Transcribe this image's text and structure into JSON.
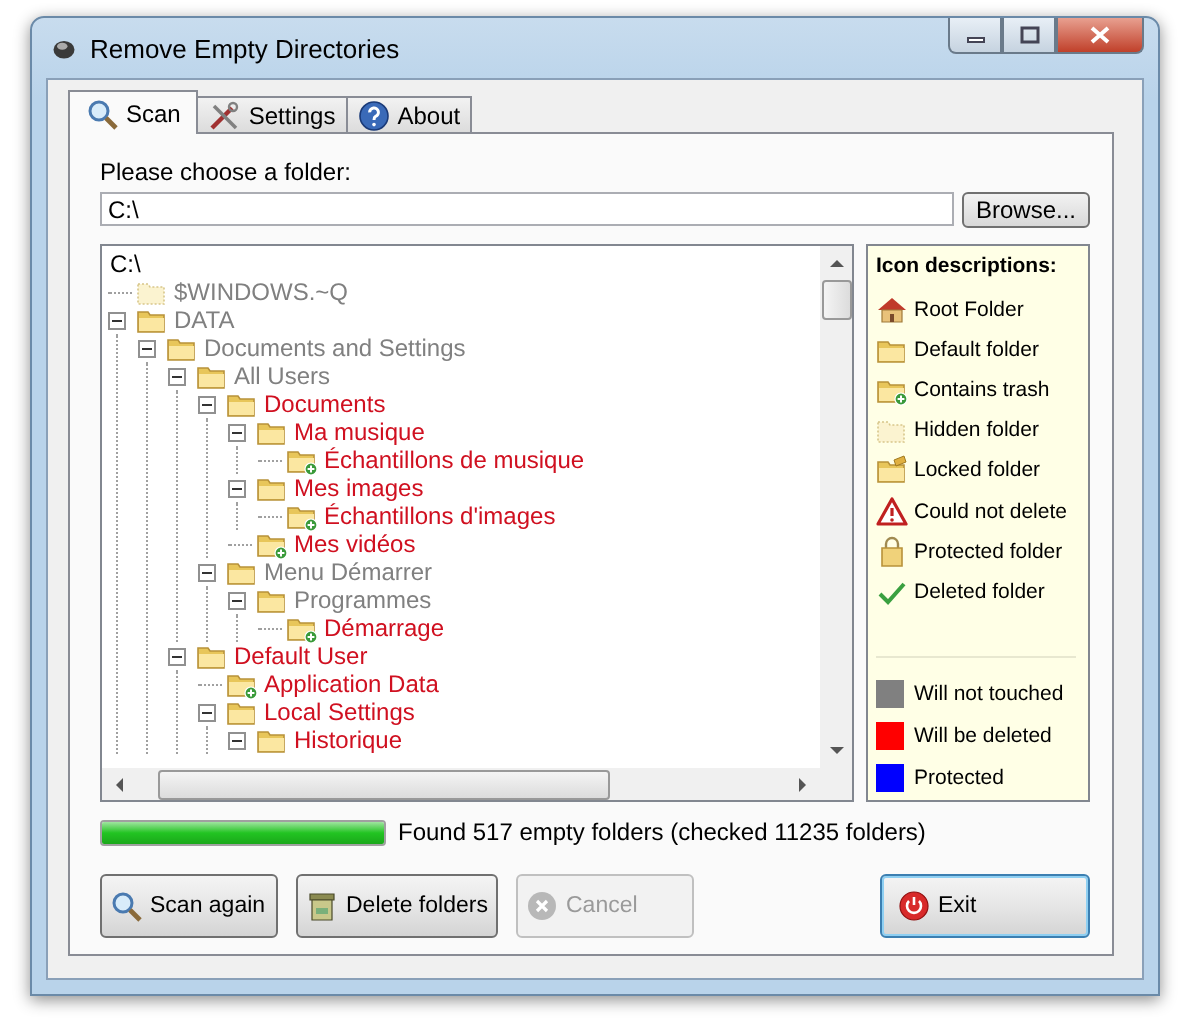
{
  "window": {
    "title": "Remove Empty Directories"
  },
  "tabs": [
    {
      "label": "Scan",
      "selected": true
    },
    {
      "label": "Settings",
      "selected": false
    },
    {
      "label": "About",
      "selected": false
    }
  ],
  "folder_label": "Please choose a folder:",
  "folder_field": {
    "value": "C:\\"
  },
  "browse_button": "Browse...",
  "tree": {
    "root": "C:\\",
    "items": [
      {
        "label": "$WINDOWS.~Q",
        "kind": "hidden",
        "color": "#808080"
      },
      {
        "label": "DATA",
        "kind": "default",
        "color": "#808080",
        "expanded": true,
        "children": [
          {
            "label": "Documents and Settings",
            "kind": "default",
            "color": "#808080",
            "expanded": true,
            "children": [
              {
                "label": "All Users",
                "kind": "default",
                "color": "#808080",
                "expanded": true,
                "children": [
                  {
                    "label": "Documents",
                    "kind": "default",
                    "color": "#d01020",
                    "expanded": true,
                    "children": [
                      {
                        "label": "Ma musique",
                        "kind": "default",
                        "color": "#d01020",
                        "expanded": true,
                        "children": [
                          {
                            "label": "Échantillons de musique",
                            "kind": "trash",
                            "color": "#d01020"
                          }
                        ]
                      },
                      {
                        "label": "Mes images",
                        "kind": "default",
                        "color": "#d01020",
                        "expanded": true,
                        "children": [
                          {
                            "label": "Échantillons d'images",
                            "kind": "trash",
                            "color": "#d01020"
                          }
                        ]
                      },
                      {
                        "label": "Mes vidéos",
                        "kind": "trash",
                        "color": "#d01020"
                      }
                    ]
                  },
                  {
                    "label": "Menu Démarrer",
                    "kind": "default",
                    "color": "#808080",
                    "expanded": true,
                    "children": [
                      {
                        "label": "Programmes",
                        "kind": "default",
                        "color": "#808080",
                        "expanded": true,
                        "children": [
                          {
                            "label": "Démarrage",
                            "kind": "trash",
                            "color": "#d01020"
                          }
                        ]
                      }
                    ]
                  }
                ]
              },
              {
                "label": "Default User",
                "kind": "default",
                "color": "#d01020",
                "expanded": true,
                "children": [
                  {
                    "label": "Application Data",
                    "kind": "trash",
                    "color": "#d01020"
                  },
                  {
                    "label": "Local Settings",
                    "kind": "default",
                    "color": "#d01020",
                    "expanded": true,
                    "children": [
                      {
                        "label": "Historique",
                        "kind": "default",
                        "color": "#d01020",
                        "expanded": true
                      }
                    ]
                  }
                ]
              }
            ]
          }
        ]
      }
    ]
  },
  "legend": {
    "title": "Icon descriptions:",
    "icons": [
      {
        "kind": "root",
        "label": "Root Folder"
      },
      {
        "kind": "default",
        "label": "Default folder"
      },
      {
        "kind": "trash",
        "label": "Contains trash"
      },
      {
        "kind": "hidden",
        "label": "Hidden folder"
      },
      {
        "kind": "locked",
        "label": "Locked folder"
      },
      {
        "kind": "error",
        "label": "Could not delete"
      },
      {
        "kind": "protected",
        "label": "Protected folder"
      },
      {
        "kind": "deleted",
        "label": "Deleted folder"
      }
    ],
    "colors": [
      {
        "color": "#808080",
        "label": "Will not touched"
      },
      {
        "color": "#ff0000",
        "label": "Will be deleted"
      },
      {
        "color": "#0000ff",
        "label": "Protected"
      }
    ]
  },
  "progress": {
    "level": 1,
    "text": "Found 517 empty folders (checked 11235 folders)"
  },
  "buttons": [
    {
      "label": "Scan again",
      "disabled": false,
      "default": false
    },
    {
      "label": "Delete folders",
      "disabled": false,
      "default": false
    },
    {
      "label": "Cancel",
      "disabled": true,
      "default": false
    },
    {
      "label": "Exit",
      "disabled": false,
      "default": true
    }
  ]
}
